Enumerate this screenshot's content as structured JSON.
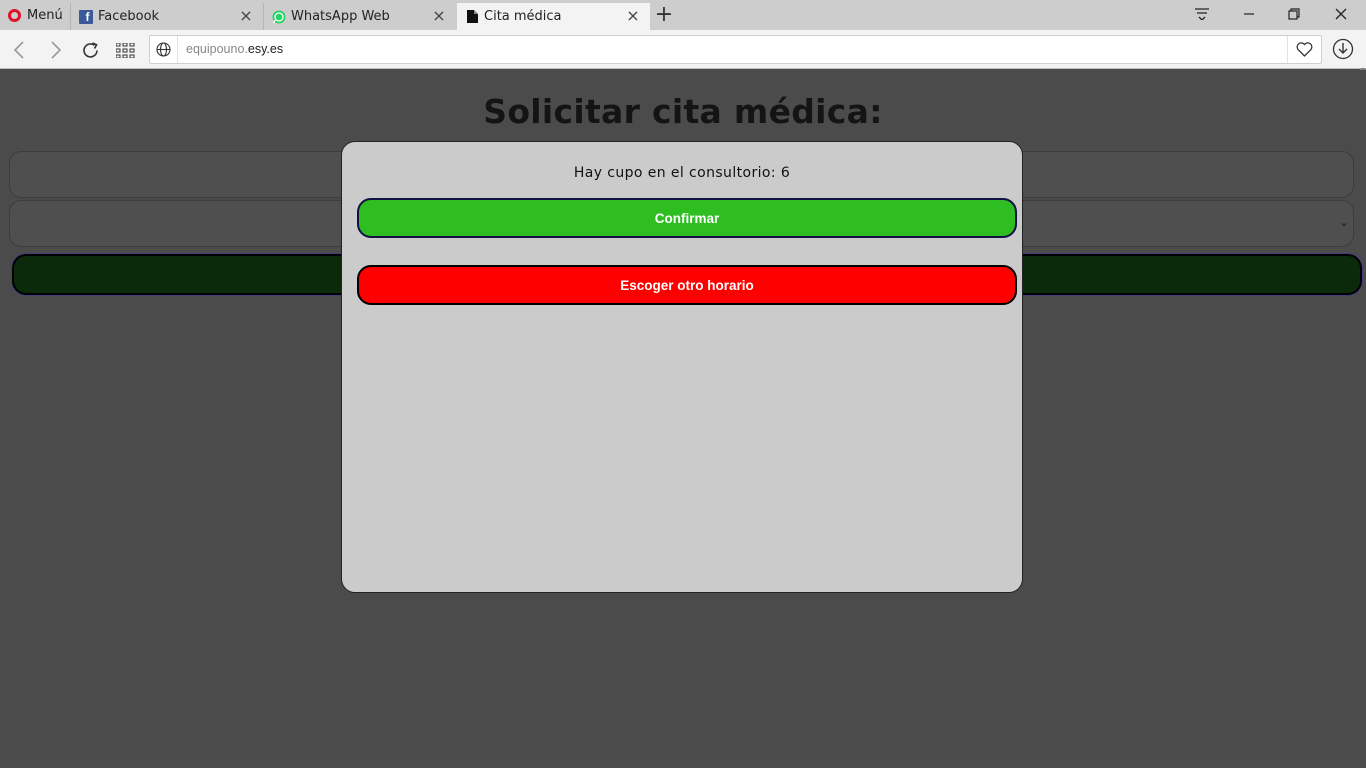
{
  "browser": {
    "menu_label": "Menú",
    "tabs": [
      {
        "label": "Facebook",
        "icon": "facebook-icon",
        "active": false
      },
      {
        "label": "WhatsApp Web",
        "icon": "whatsapp-icon",
        "active": false
      },
      {
        "label": "Cita médica",
        "icon": "document-icon",
        "active": true
      }
    ],
    "address": {
      "url_prefix": "equipouno.",
      "url_domain": "esy.es"
    }
  },
  "page": {
    "title": "Solicitar cita médica:"
  },
  "modal": {
    "message": "Hay cupo en el consultorio: 6",
    "confirm_label": "Confirmar",
    "other_label": "Escoger otro horario"
  },
  "colors": {
    "confirm": "#2fbe22",
    "cancel": "#ff0000",
    "overlay": "#4b4b4b",
    "modal_bg": "#cbcbcb"
  }
}
